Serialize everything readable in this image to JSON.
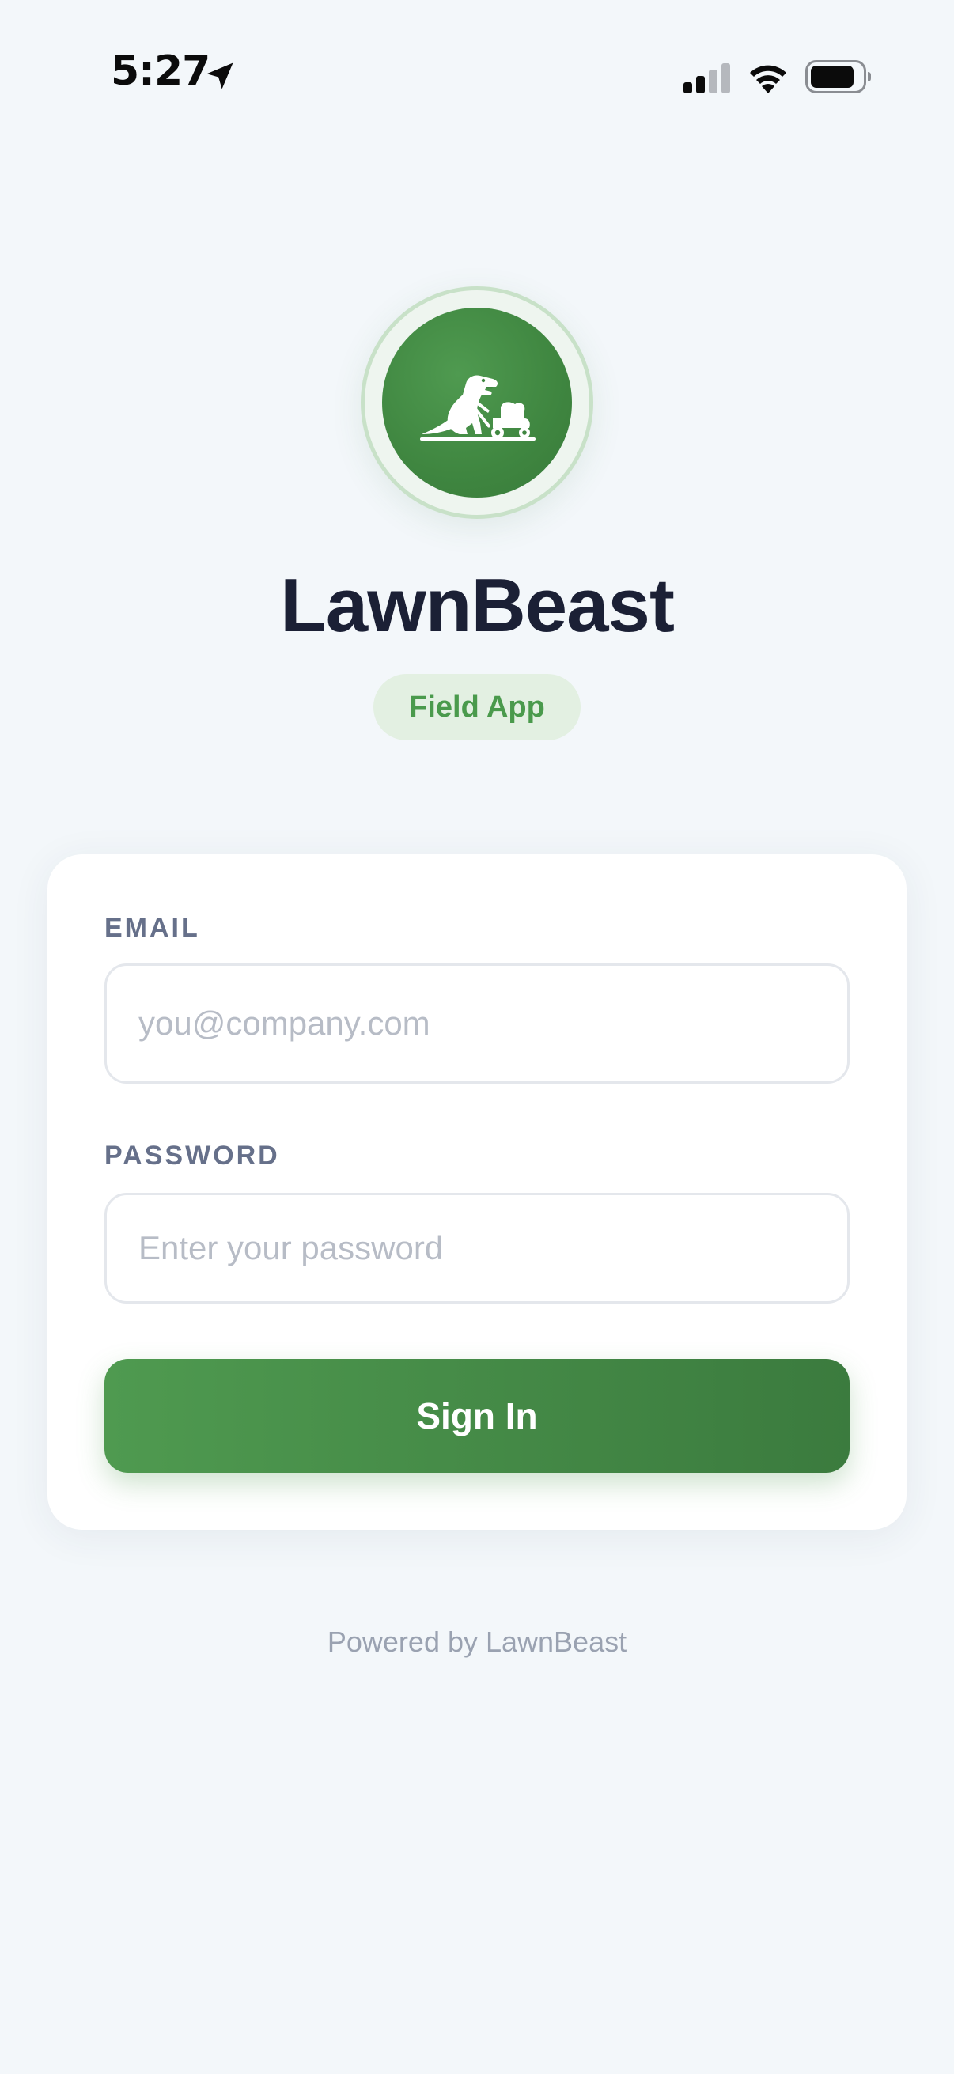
{
  "status_bar": {
    "time": "5:27",
    "icons": [
      "location-arrow-icon",
      "cellular-signal-icon",
      "wifi-icon",
      "battery-icon"
    ]
  },
  "branding": {
    "logo_icon": "dinosaur-lawnmower-icon",
    "app_name": "LawnBeast",
    "badge": "Field App"
  },
  "login_form": {
    "email_label": "EMAIL",
    "email_placeholder": "you@company.com",
    "email_value": "",
    "password_label": "PASSWORD",
    "password_placeholder": "Enter your password",
    "password_value": "",
    "submit_label": "Sign In"
  },
  "footer": {
    "text": "Powered by LawnBeast"
  },
  "colors": {
    "background": "#f3f7fa",
    "brand_green": "#4a9a4c",
    "brand_green_dark": "#3b7b3e",
    "title_text": "#1b2035",
    "label_text": "#66708a",
    "placeholder_text": "#b7bcc6",
    "footer_text": "#9aa2b1"
  }
}
